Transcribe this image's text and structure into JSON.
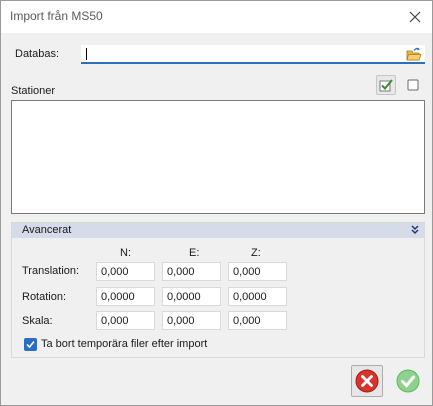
{
  "window": {
    "title": "Import från MS50"
  },
  "database": {
    "label": "Databas:",
    "value": ""
  },
  "stations": {
    "label": "Stationer",
    "items": []
  },
  "advanced": {
    "title": "Avancerat",
    "columns": [
      "N:",
      "E:",
      "Z:"
    ],
    "rows": [
      {
        "label": "Translation:",
        "values": [
          "0,000",
          "0,000",
          "0,000"
        ]
      },
      {
        "label": "Rotation:",
        "values": [
          "0,0000",
          "0,0000",
          "0,0000"
        ]
      },
      {
        "label": "Skala:",
        "values": [
          "0,000",
          "0,000",
          "0,000"
        ]
      }
    ],
    "delete_temp_files": {
      "label": "Ta bort temporära filer efter import",
      "checked": true
    }
  },
  "icons": {
    "close": "close-icon",
    "folder": "folder-open-icon",
    "check_all": "check-all-icon",
    "uncheck_all": "uncheck-all-icon",
    "expand": "chevron-double-down-icon",
    "cancel": "cancel-icon",
    "ok": "ok-icon"
  },
  "colors": {
    "accent": "#2b6cc4",
    "header_band": "#d6dbe9",
    "cancel_red": "#d9342b",
    "ok_green": "#5cb85c"
  }
}
